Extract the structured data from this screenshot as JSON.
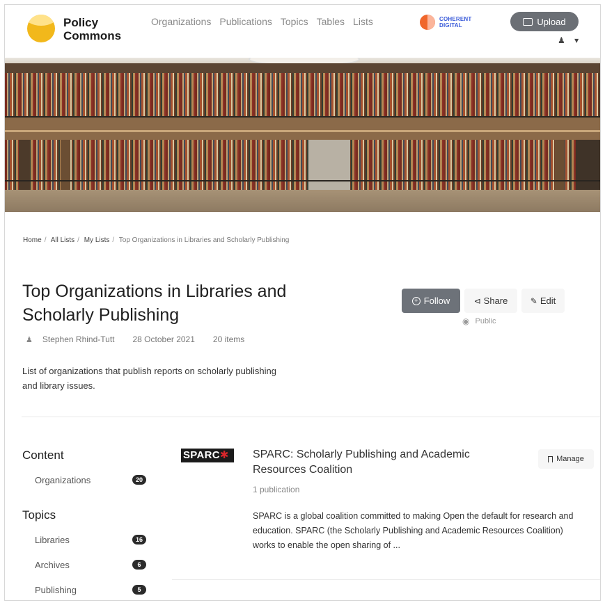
{
  "header": {
    "logo_line1": "Policy",
    "logo_line2": "Commons",
    "nav": [
      "Organizations",
      "Publications",
      "Topics",
      "Tables",
      "Lists"
    ],
    "partner_line1": "COHERENT",
    "partner_line2": "DIGITAL",
    "upload_label": "Upload",
    "user_icon": "person-icon",
    "chevron_icon": "chevron-down-icon"
  },
  "breadcrumb": [
    "Home",
    "All Lists",
    "My Lists",
    "Top Organizations in Libraries and Scholarly Publishing"
  ],
  "list": {
    "title": "Top Organizations in Libraries and Scholarly Publishing",
    "author": "Stephen Rhind-Tutt",
    "date": "28 October 2021",
    "item_count": "20 items",
    "description": "List of organizations that publish reports on scholarly publishing and library issues.",
    "visibility": "Public"
  },
  "actions": {
    "follow_label": "Follow",
    "share_label": "Share",
    "edit_label": "Edit"
  },
  "sidebar": {
    "content_heading": "Content",
    "content_items": [
      {
        "label": "Organizations",
        "count": "20"
      }
    ],
    "topics_heading": "Topics",
    "topic_items": [
      {
        "label": "Libraries",
        "count": "16"
      },
      {
        "label": "Archives",
        "count": "6"
      },
      {
        "label": "Publishing",
        "count": "5"
      }
    ]
  },
  "result": {
    "logo_text": "SPARC",
    "title": "SPARC: Scholarly Publishing and Academic Resources Coalition",
    "subtitle": "1 publication",
    "description": "SPARC is a global coalition committed to making Open the default for research and education. SPARC (the Scholarly Publishing and Academic Resources Coalition) works to enable the open sharing of ...",
    "manage_label": "Manage"
  },
  "colors": {
    "logo_yellow": "#f2b81b",
    "partner_orange": "#f0662b",
    "partner_blue": "#3a5bd9",
    "button_gray": "#6d7279",
    "badge_dark": "#2b2b2b"
  }
}
